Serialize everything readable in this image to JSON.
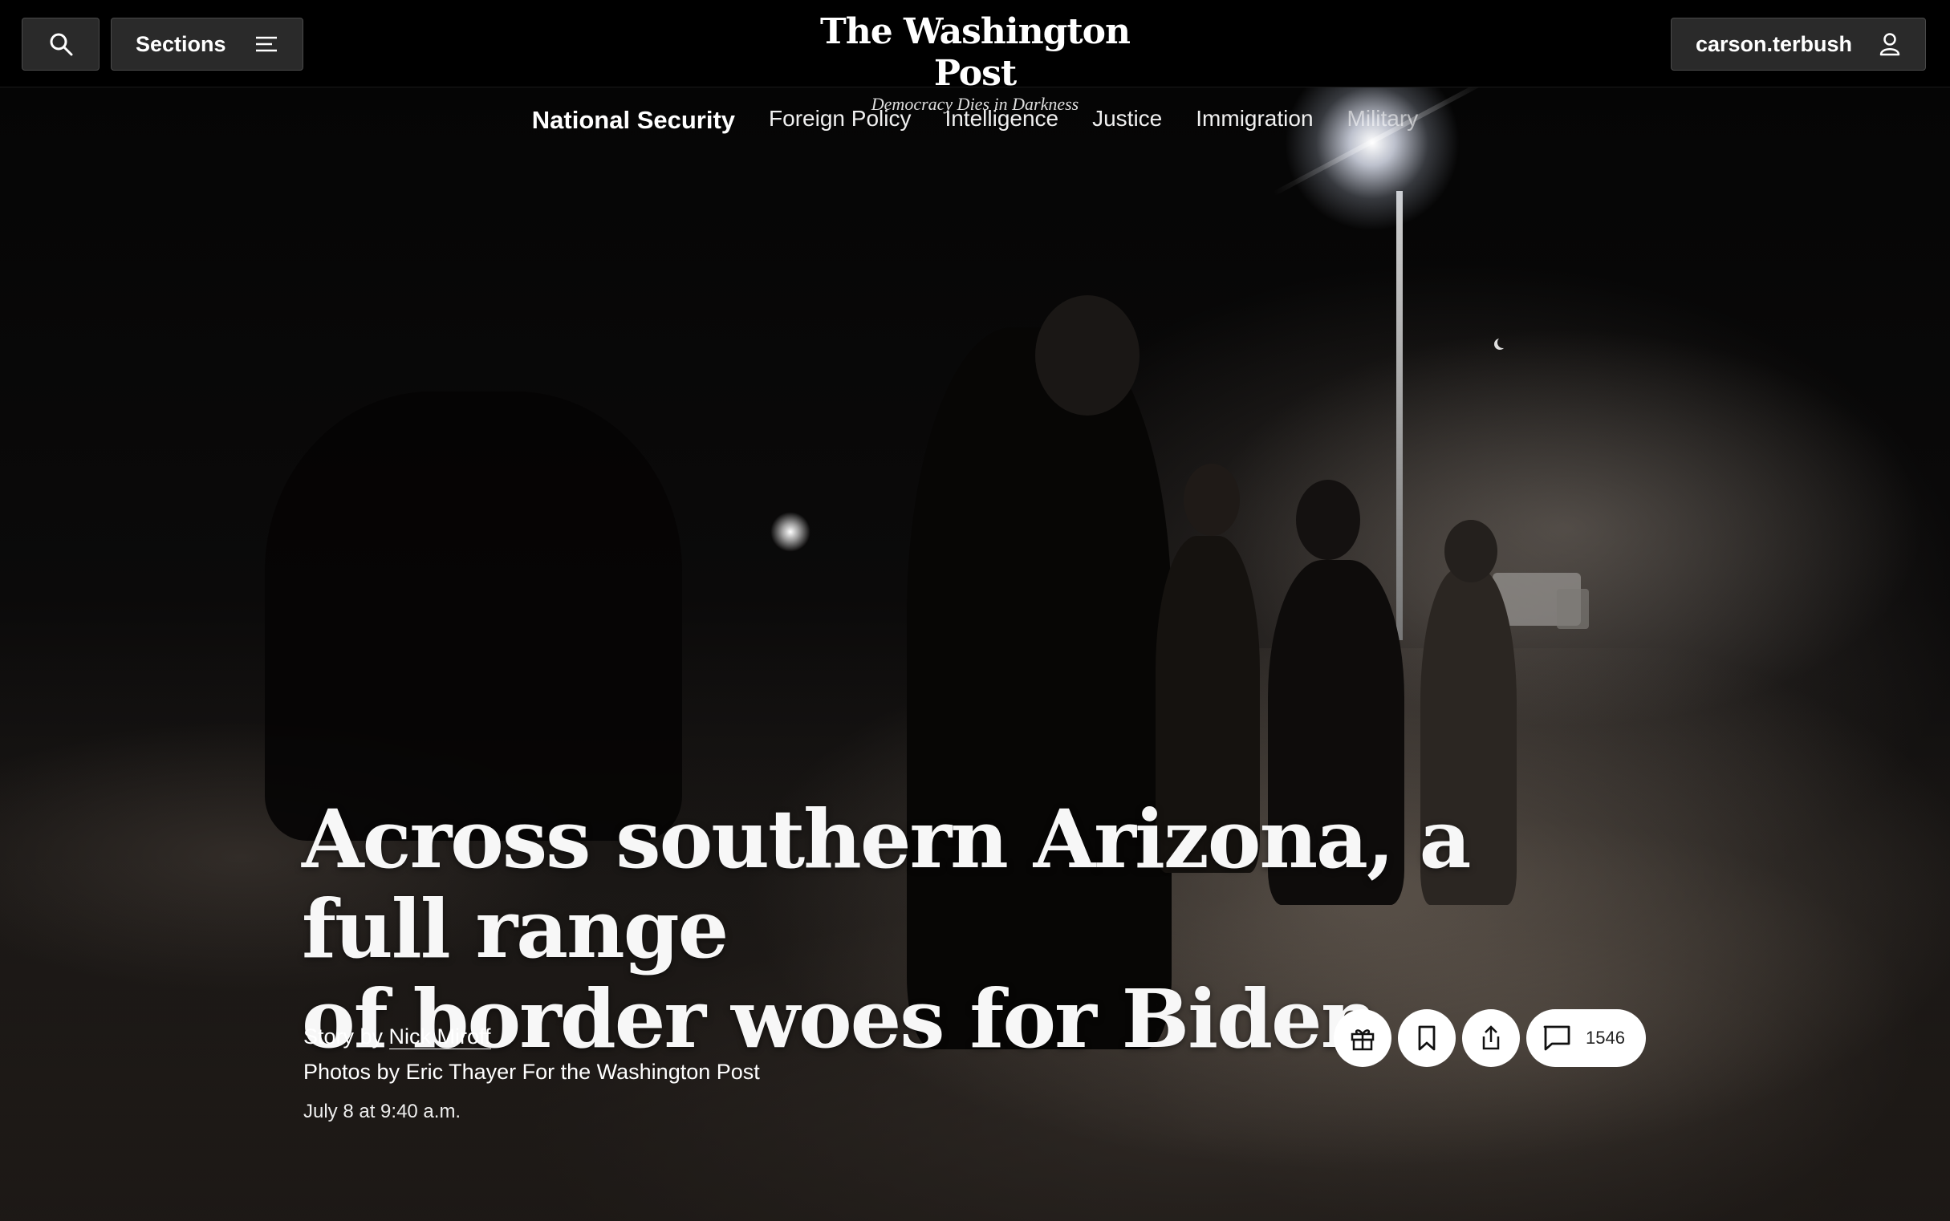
{
  "header": {
    "sections_label": "Sections",
    "masthead_title": "The Washington Post",
    "masthead_tagline": "Democracy Dies in Darkness",
    "account_label": "carson.terbush"
  },
  "section_nav": {
    "items": [
      {
        "label": "National Security"
      },
      {
        "label": "Foreign Policy"
      },
      {
        "label": "Intelligence"
      },
      {
        "label": "Justice"
      },
      {
        "label": "Immigration"
      },
      {
        "label": "Military"
      }
    ]
  },
  "article": {
    "headline_line1": "Across southern Arizona, a full range",
    "headline_line2": "of border woes for Biden",
    "story_prefix": "Story by ",
    "author": "Nick Miroff",
    "photo_credit": "Photos by Eric Thayer For the Washington Post",
    "date": "July 8 at 9:40 a.m.",
    "comment_count": "1546"
  },
  "icons": {
    "search": "search-icon",
    "menu": "menu-lines-icon",
    "user": "user-icon",
    "gift": "gift-icon",
    "bookmark": "bookmark-icon",
    "share": "share-icon",
    "comment": "comment-icon"
  },
  "colors": {
    "background": "#000000",
    "button_bg": "#2a2a2a",
    "action_button_bg": "#ffffff",
    "text": "#ffffff"
  }
}
